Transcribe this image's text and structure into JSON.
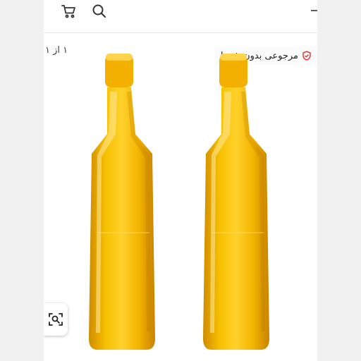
{
  "header": {
    "cart_icon": "cart-icon",
    "search_icon": "search-icon",
    "close_icon": "close-icon"
  },
  "gallery": {
    "counter": "۱ از ۱",
    "badge_text": "مرجوعی بدون شرط",
    "badge_icon": "shield-icon",
    "badge_color": "#e53935",
    "product_color": "#f2b705",
    "cap_color": "#f4b000",
    "visual_search_icon": "camera-search-icon"
  }
}
